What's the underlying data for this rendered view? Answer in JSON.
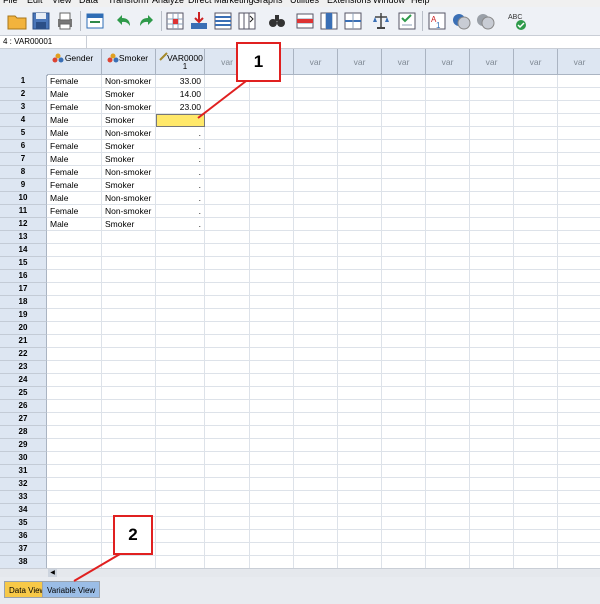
{
  "menu": [
    "File",
    "Edit",
    "View",
    "Data",
    "Transform",
    "Analyze",
    "Direct Marketing",
    "Graphs",
    "Utilities",
    "Extensions",
    "Window",
    "Help"
  ],
  "cell_reference": "4 : VAR00001",
  "columns": {
    "gender": "Gender",
    "smoker": "Smoker",
    "var_new_name": "VAR0000",
    "var_new_sub": "1",
    "var_placeholder": "var"
  },
  "row_numbers": [
    "1",
    "2",
    "3",
    "4",
    "5",
    "6",
    "7",
    "8",
    "9",
    "10",
    "11",
    "12",
    "13",
    "14",
    "15",
    "16",
    "17",
    "18",
    "19",
    "20",
    "21",
    "22",
    "23",
    "24",
    "25",
    "26",
    "27",
    "28",
    "29",
    "30",
    "31",
    "32",
    "33",
    "34",
    "35",
    "36",
    "37",
    "38"
  ],
  "rows": [
    {
      "gender": "Female",
      "smoker": "Non-smoker",
      "var": "33.00"
    },
    {
      "gender": "Male",
      "smoker": "Smoker",
      "var": "14.00"
    },
    {
      "gender": "Female",
      "smoker": "Non-smoker",
      "var": "23.00"
    },
    {
      "gender": "Male",
      "smoker": "Smoker",
      "var": ""
    },
    {
      "gender": "Male",
      "smoker": "Non-smoker",
      "var": "."
    },
    {
      "gender": "Female",
      "smoker": "Smoker",
      "var": "."
    },
    {
      "gender": "Male",
      "smoker": "Smoker",
      "var": "."
    },
    {
      "gender": "Female",
      "smoker": "Non-smoker",
      "var": "."
    },
    {
      "gender": "Female",
      "smoker": "Smoker",
      "var": "."
    },
    {
      "gender": "Male",
      "smoker": "Non-smoker",
      "var": "."
    },
    {
      "gender": "Female",
      "smoker": "Non-smoker",
      "var": "."
    },
    {
      "gender": "Male",
      "smoker": "Smoker",
      "var": "."
    }
  ],
  "tabs": {
    "data_view": "Data View",
    "variable_view": "Variable View"
  },
  "annotations": {
    "one": "1",
    "two": "2"
  },
  "colors": {
    "header_bg": "#dde6f2",
    "selected_cell": "#ffe86a",
    "callout_border": "#e02020",
    "active_tab": "#f7c948",
    "inactive_tab": "#9bbde6"
  },
  "icons": [
    "open-folder-icon",
    "save-icon",
    "print-icon",
    "dialog-recall-icon",
    "undo-icon",
    "redo-icon",
    "goto-case-icon",
    "goto-variable-icon",
    "variables-icon",
    "run-descriptives-icon",
    "find-icon",
    "insert-cases-icon",
    "insert-variable-icon",
    "split-file-icon",
    "weight-cases-icon",
    "select-cases-icon",
    "value-labels-icon",
    "use-sets-icon",
    "show-all-variables-icon",
    "spell-check-icon"
  ]
}
